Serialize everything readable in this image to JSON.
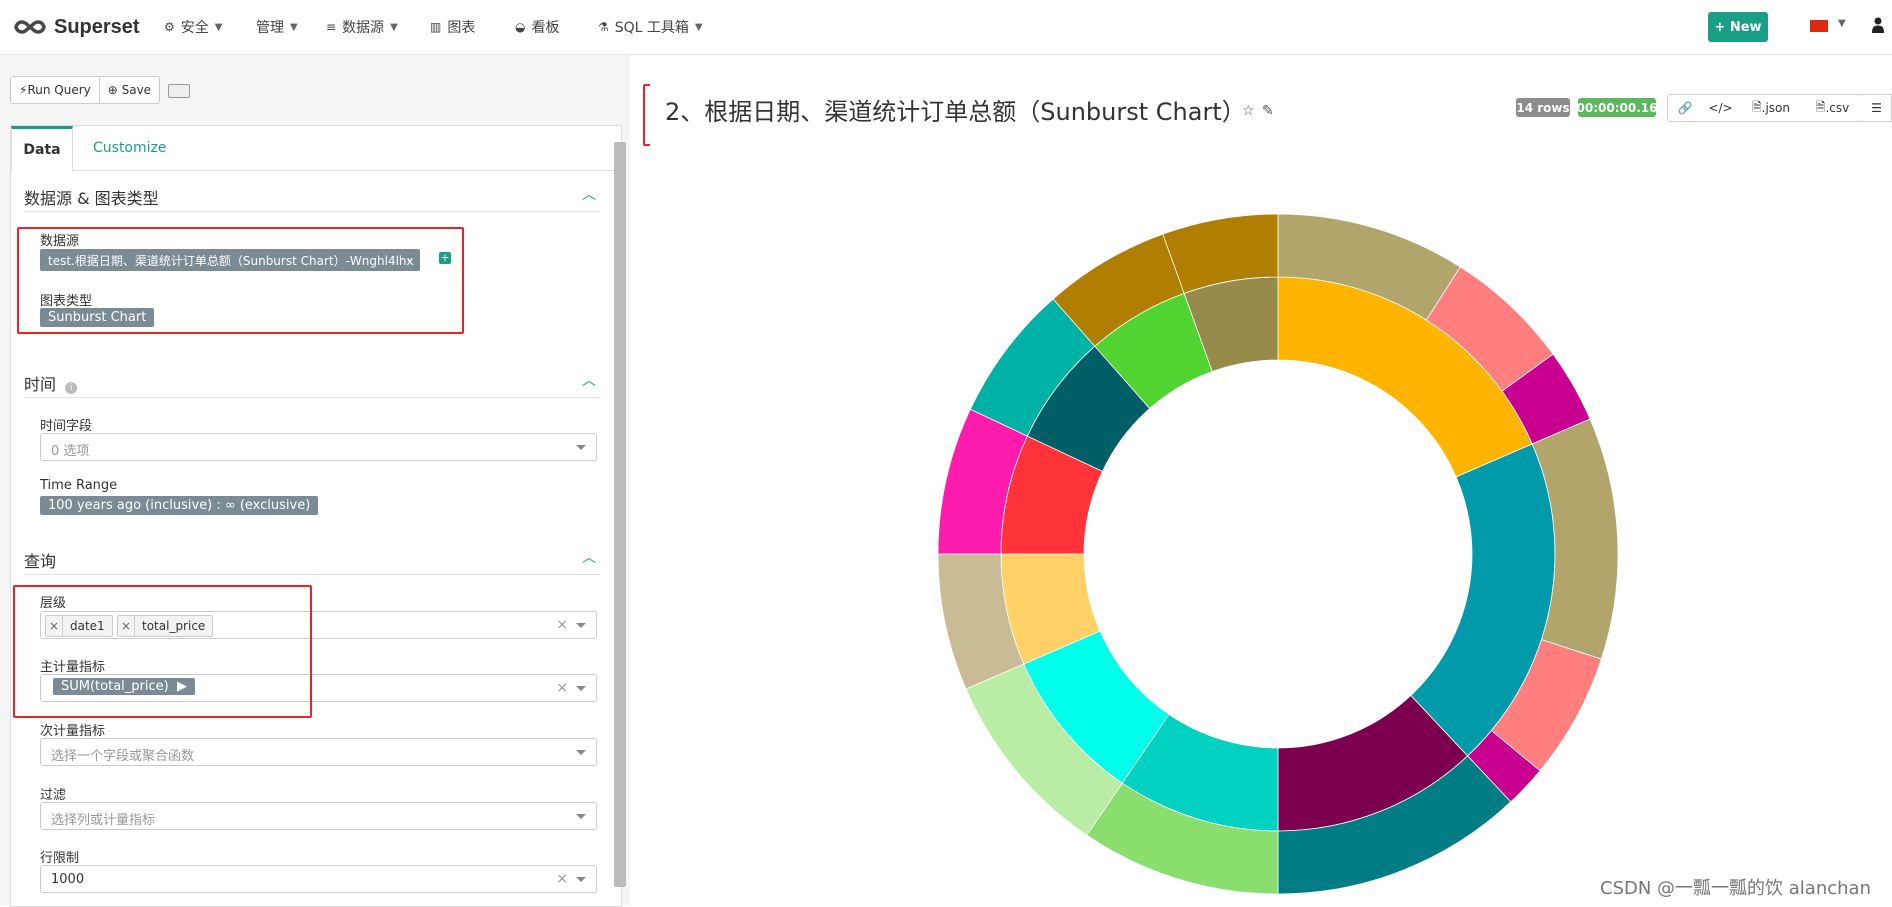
{
  "nav": {
    "brand": "Superset",
    "menu": [
      {
        "label": "安全",
        "icon": "gears-icon"
      },
      {
        "label": "管理",
        "icon": ""
      },
      {
        "label": "数据源",
        "icon": "database-icon"
      },
      {
        "label": "图表",
        "icon": "bar-chart-icon"
      },
      {
        "label": "看板",
        "icon": "dashboard-icon"
      },
      {
        "label": "SQL 工具箱",
        "icon": "flask-icon"
      }
    ],
    "new_label": "New"
  },
  "toolbar": {
    "run_query": "Run Query",
    "save": "Save"
  },
  "tabs": {
    "data": "Data",
    "customize": "Customize"
  },
  "sections": {
    "datasource": {
      "title": "数据源 & 图表类型",
      "datasource_label": "数据源",
      "datasource_value": "test.根据日期、渠道统计订单总额（Sunburst Chart）-Wnghl4lhx",
      "viz_label": "图表类型",
      "viz_value": "Sunburst Chart"
    },
    "time": {
      "title": "时间",
      "time_column_label": "时间字段",
      "time_column_placeholder": "0 选项",
      "time_range_label": "Time Range",
      "time_range_value": "100 years ago (inclusive) : ∞ (exclusive)"
    },
    "query": {
      "title": "查询",
      "hierarchy_label": "层级",
      "hierarchy_values": [
        "date1",
        "total_price"
      ],
      "metric_label": "主计量指标",
      "metric_value": "SUM(total_price)",
      "secondary_metric_label": "次计量指标",
      "secondary_metric_placeholder": "选择一个字段或聚合函数",
      "filters_label": "过滤",
      "filters_placeholder": "选择列或计量指标",
      "row_limit_label": "行限制",
      "row_limit_value": "1000"
    }
  },
  "chart": {
    "title": "2、根据日期、渠道统计订单总额（Sunburst Chart）",
    "rows_badge": "14 rows",
    "time_badge": "00:00:00.16",
    "json_label": ".json",
    "csv_label": ".csv",
    "colors": {
      "accent": "#1a9f86",
      "rows_badge": "#8c8c8c",
      "time_badge": "#5cb85c"
    }
  },
  "chart_data": {
    "type": "sunburst",
    "inner": [
      {
        "value": 18.5,
        "color": "#ffb400"
      },
      {
        "value": 19.5,
        "color": "#009aab"
      },
      {
        "value": 12.0,
        "color": "#7c004f"
      },
      {
        "value": 9.5,
        "color": "#00d1c1"
      },
      {
        "value": 9.0,
        "color": "#00ffeb"
      },
      {
        "value": 6.5,
        "color": "#ffd166"
      },
      {
        "value": 7.0,
        "color": "#ff3339"
      },
      {
        "value": 6.5,
        "color": "#005f66"
      },
      {
        "value": 6.0,
        "color": "#51d330"
      },
      {
        "value": 5.5,
        "color": "#968b4a"
      }
    ],
    "outer": [
      {
        "value": 9.0,
        "color": "#b2a56c"
      },
      {
        "value": 6.0,
        "color": "#ff7f7f"
      },
      {
        "value": 3.5,
        "color": "#c9008f"
      },
      {
        "value": 11.5,
        "color": "#b2a56c"
      },
      {
        "value": 6.0,
        "color": "#ff7f7f"
      },
      {
        "value": 2.0,
        "color": "#c9008f"
      },
      {
        "value": 12.0,
        "color": "#007c85"
      },
      {
        "value": 9.5,
        "color": "#8ade6e"
      },
      {
        "value": 9.0,
        "color": "#b9eda6"
      },
      {
        "value": 6.5,
        "color": "#c9bc94"
      },
      {
        "value": 7.0,
        "color": "#ff1bad"
      },
      {
        "value": 6.5,
        "color": "#00b2a5"
      },
      {
        "value": 6.0,
        "color": "#b07e00"
      },
      {
        "value": 5.5,
        "color": "#b07e00"
      }
    ]
  },
  "watermark": "CSDN @一瓢一瓢的饮 alanchan"
}
